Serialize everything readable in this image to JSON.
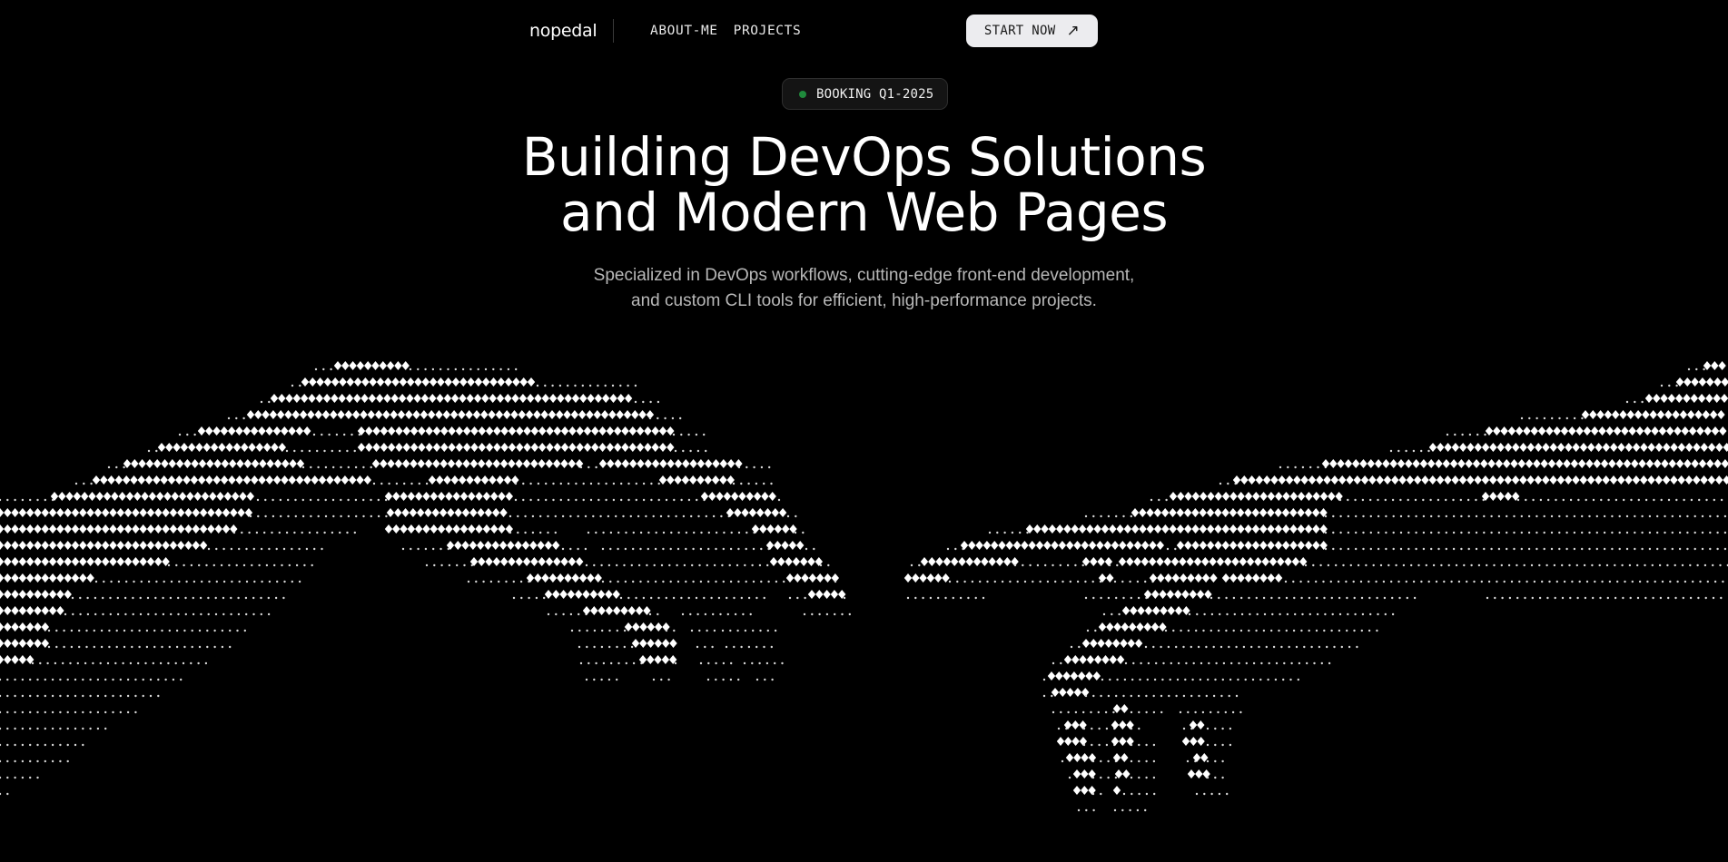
{
  "nav": {
    "logo": "nopedal",
    "links": [
      "ABOUT-ME",
      "PROJECTS"
    ],
    "cta_label": "START NOW",
    "cta_icon": "arrow-up-right-icon"
  },
  "badge": {
    "label": "BOOKING Q1-2025",
    "status_color": "#1f8a3c"
  },
  "hero": {
    "title_line1": "Building DevOps Solutions",
    "title_line2": "and Modern Web Pages",
    "subtitle_line1": "Specialized in DevOps workflows, cutting-edge front-end development,",
    "subtitle_line2": "and custom CLI tools for efficient, high-performance projects."
  },
  "colors": {
    "background": "#000000",
    "text": "#ffffff",
    "muted_text": "#b8b8b8",
    "button_bg": "#ececef"
  }
}
